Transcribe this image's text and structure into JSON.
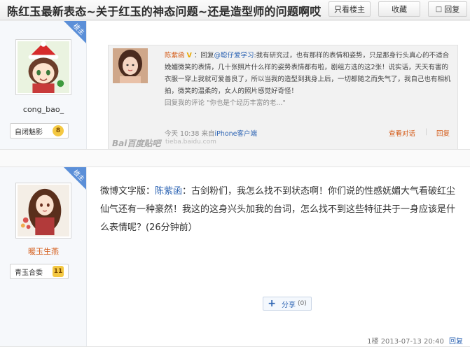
{
  "header": {
    "title": "陈红玉最新表态~关于红玉的神态问题~还是造型师的问题啊哎",
    "only_op_label": "只看楼主",
    "favorite_label": "收藏",
    "reply_label": "回复"
  },
  "post1": {
    "op_badge": "楼主",
    "username": "cong_bao_",
    "level_name": "自闭魅影",
    "level_num": "8",
    "quote": {
      "name": "陈紫函",
      "reply_prefix": "：回复",
      "reply_to": "@聪仔爱学习",
      "text": ":我有研究过，也有那样的表情和姿势，只是那身行头真心的不适合娩媚微笑的表情，几十张照片什么样的姿势表情都有啦，剧组方选的这2张！说实话，天天有害的衣服一穿上我就可爱善良了，所以当我的造型到我身上后，一切都随之而失气了，我自己也有相机拍，微笑的温柔的，女人的照片感觉好奇怪！",
      "comment_label": "回复我的评论",
      "comment_text": "\"你也是个经历丰富的老...\"",
      "time": "今天 10:38",
      "source_prefix": "来自",
      "source": "iPhone客户端",
      "view_conv": "查看对话",
      "reply": "回复"
    },
    "watermark": "Bai百度贴吧",
    "watermark_sub": "tieba.baidu.com"
  },
  "post2": {
    "op_badge": "楼主",
    "username": "暖玉生燕",
    "level_name": "青玉合委",
    "level_num": "11",
    "content_prefix": "微博文字版：",
    "content_author": "陈紫函",
    "content_text": "：古剑粉们，我怎么找不到状态啊！你们说的性感妩媚大气看破红尘仙气还有一种豪然！我这的这身兴头加我的台词，怎么找不到这些特征共于一身应该是什么表情呢？(26分钟前）",
    "share_label": "分享",
    "share_count": "(0)",
    "floor": "1楼",
    "date": "2013-07-13 20:40",
    "reply": "回复"
  },
  "colors": {
    "link": "#2d64b3",
    "name_orange": "#d45b18",
    "op_badge": "#5b8fd8"
  }
}
